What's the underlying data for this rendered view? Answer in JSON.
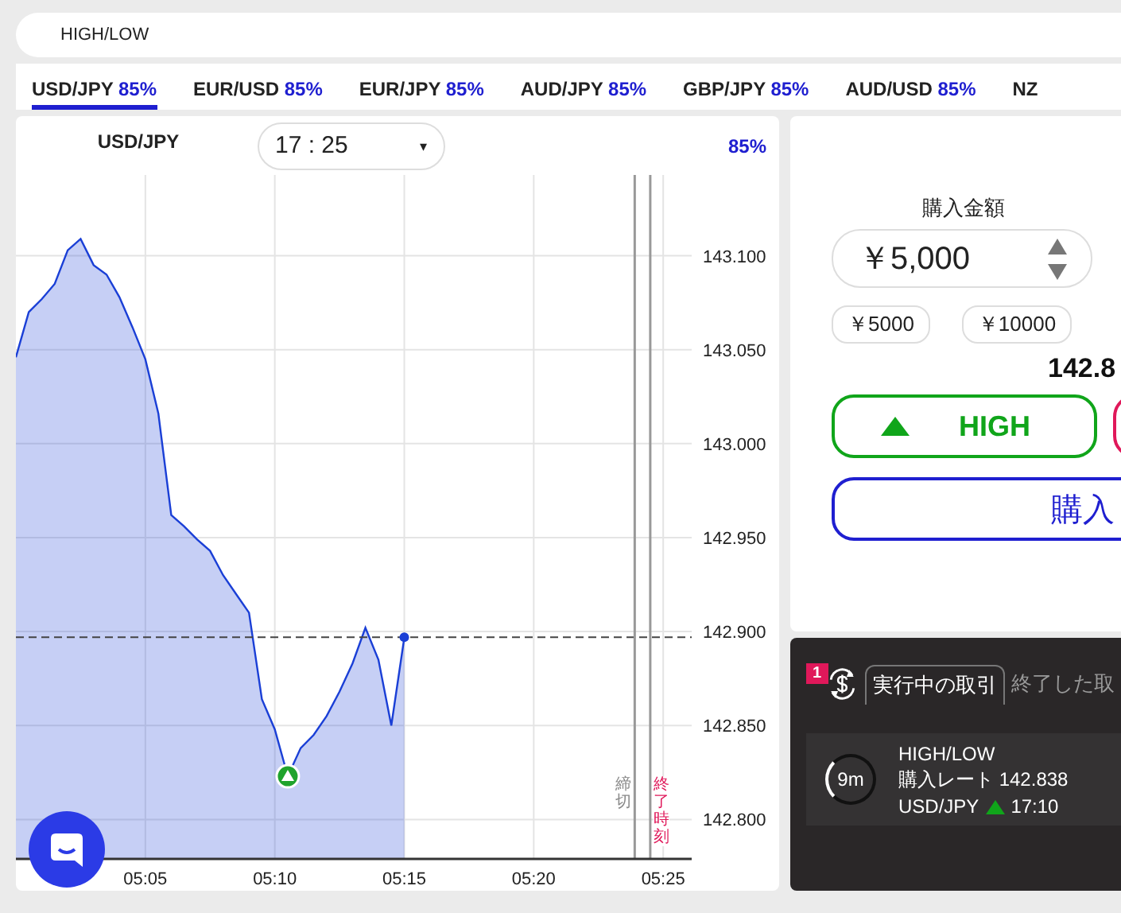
{
  "header": {
    "title": "HIGH/LOW"
  },
  "tabs": [
    {
      "pair": "USD/JPY",
      "payout": "85%",
      "selected": true
    },
    {
      "pair": "EUR/USD",
      "payout": "85%",
      "selected": false
    },
    {
      "pair": "EUR/JPY",
      "payout": "85%",
      "selected": false
    },
    {
      "pair": "AUD/JPY",
      "payout": "85%",
      "selected": false
    },
    {
      "pair": "GBP/JPY",
      "payout": "85%",
      "selected": false
    },
    {
      "pair": "AUD/USD",
      "payout": "85%",
      "selected": false
    },
    {
      "pair": "NZ",
      "selected": false
    }
  ],
  "chart_panel": {
    "pair": "USD/JPY",
    "expiry": "17 : 25",
    "caret": "▾",
    "payout": "85%",
    "time_markers": [
      {
        "kind": "deadline",
        "label": "締切"
      },
      {
        "kind": "expiry",
        "label": "終了時刻"
      }
    ],
    "chart_data": {
      "type": "area",
      "grid": true,
      "ref_lines": [
        {
          "axis": "y",
          "value": 142.897
        }
      ],
      "categories": [
        null,
        null,
        null,
        null,
        null,
        null,
        null,
        null,
        null,
        null,
        "05:05",
        null,
        null,
        null,
        null,
        null,
        null,
        null,
        null,
        null,
        "05:10",
        null,
        null,
        null,
        null,
        null,
        null,
        null,
        null,
        null,
        "05:15",
        null,
        null,
        null,
        null,
        null,
        null,
        null,
        null,
        null,
        "05:20",
        null,
        null,
        null,
        null,
        null,
        null,
        null,
        null,
        null,
        "05:25",
        null,
        null
      ],
      "series": [
        {
          "color": "#1a3fd6",
          "values": [
            143.046,
            143.07,
            143.077,
            143.085,
            143.103,
            143.109,
            143.095,
            143.09,
            143.078,
            143.062,
            143.045,
            143.016,
            142.962,
            142.956,
            142.949,
            142.943,
            142.93,
            142.92,
            142.91,
            142.864,
            142.848,
            142.823,
            142.838,
            142.845,
            142.855,
            142.868,
            142.883,
            142.902,
            142.885,
            142.85,
            142.897,
            null,
            null,
            null,
            null,
            null,
            null,
            null,
            null,
            null,
            null,
            null,
            null,
            null,
            null,
            null,
            null,
            null,
            null,
            null,
            null,
            null,
            null
          ]
        }
      ],
      "ylim": [
        142.779,
        143.143
      ],
      "yticks": [
        {
          "value": 142.8,
          "label": "142.800"
        },
        {
          "value": 142.85,
          "label": "142.850"
        },
        {
          "value": 142.9,
          "label": "142.900"
        },
        {
          "value": 142.95,
          "label": "142.950"
        },
        {
          "value": 143.0,
          "label": "143.000"
        },
        {
          "value": 143.05,
          "label": "143.050"
        },
        {
          "value": 143.1,
          "label": "143.100"
        }
      ]
    }
  },
  "order_panel": {
    "amount_label": "購入金額",
    "amount": "￥5,000",
    "presets": [
      "￥5000",
      "￥10000"
    ],
    "rate": "142.8",
    "high_button": "HIGH",
    "buy_button": "購入"
  },
  "trades_panel": {
    "badge": "1",
    "tabs": [
      {
        "label": "実行中の取引",
        "selected": true
      },
      {
        "label": "終了した取",
        "selected": false
      }
    ],
    "trade": {
      "remaining": "9m",
      "type": "HIGH/LOW",
      "rate_line": "購入レート 142.838",
      "pair": "USD/JPY",
      "time": "17:10"
    }
  }
}
